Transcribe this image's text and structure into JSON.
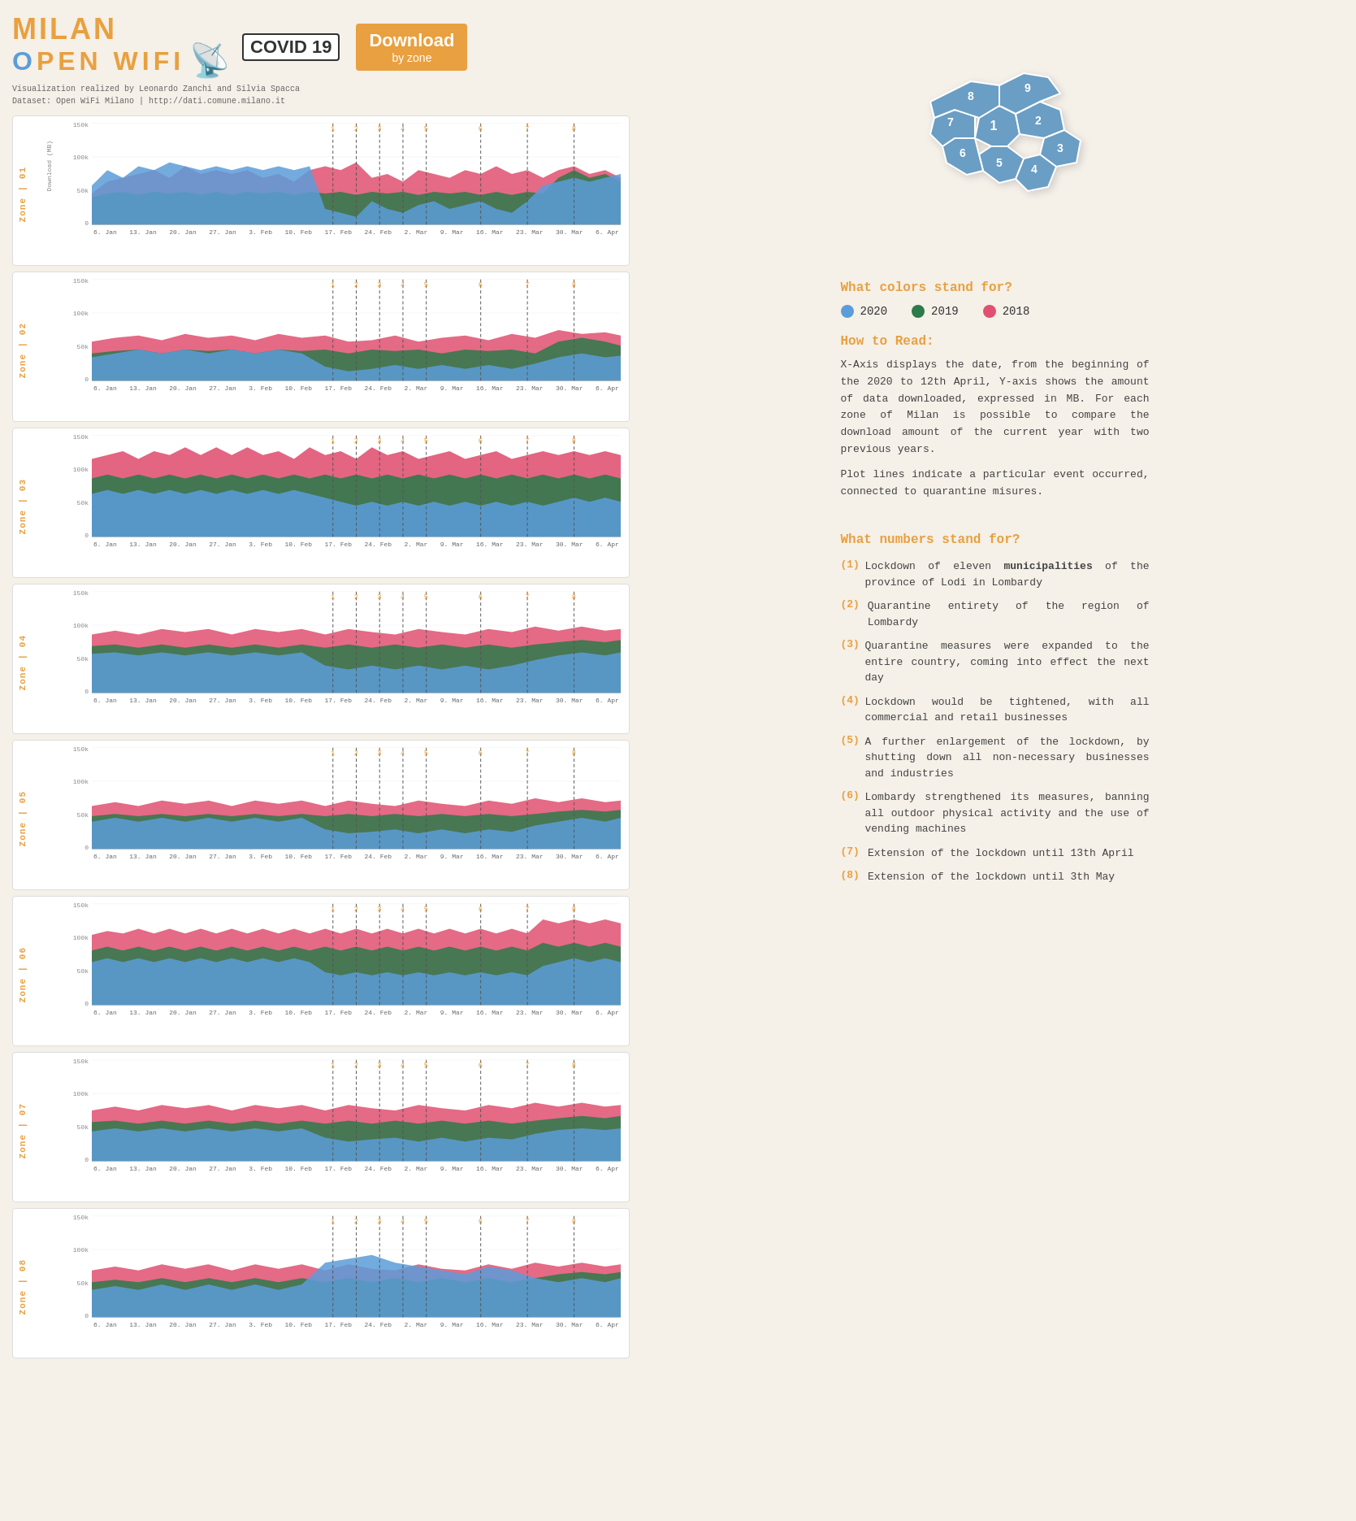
{
  "header": {
    "milan": "MILAN",
    "covid": "COVID 19",
    "open_wifi": "OPEN WIFI",
    "download": "Download",
    "by_zone": "by zone",
    "attribution1": "Visualization realized by Leonardo Zanchi and Silvia Spacca",
    "attribution2": "Dataset: Open WiFi Milano | http://dati.comune.milano.it"
  },
  "colors": {
    "year2020": "#5b9dd9",
    "year2019": "#2d7a4a",
    "year2018": "#e05070",
    "accent": "#e8a040",
    "dashed_line": "#555",
    "grid": "#eee"
  },
  "legend": {
    "title": "What colors stand for?",
    "items": [
      {
        "year": "2020",
        "color": "#5b9dd9"
      },
      {
        "year": "2019",
        "color": "#2d7a4a"
      },
      {
        "year": "2018",
        "color": "#e05070"
      }
    ]
  },
  "how_to_read": {
    "title": "How to Read:",
    "body1": "X-Axis displays the date, from the beginning of the 2020 to 12th April, Y-axis shows the amount of data downloaded, expressed in MB. For each zone of Milan is possible to compare the download amount of the current year with two previous years.",
    "body2": "Plot lines indicate a particular event occurred, connected to quarantine misures."
  },
  "what_numbers": {
    "title": "What numbers stand for?",
    "items": [
      {
        "num": "(1)",
        "text": "Lockdown of eleven ",
        "bold": "municipalities",
        "text2": " of the province of Lodi in Lombardy"
      },
      {
        "num": "(2)",
        "text": "Quarantine entirety of the region of Lombardy"
      },
      {
        "num": "(3)",
        "text": "Quarantine measures were expanded to the entire country, coming into effect the next day"
      },
      {
        "num": "(4)",
        "text": "Lockdown would be tightened, with all commercial and retail businesses"
      },
      {
        "num": "(5)",
        "text": "A further enlargement of the lockdown, by shutting down all non-necessary businesses and industries"
      },
      {
        "num": "(6)",
        "text": "Lombardy strengthened its measures, banning all outdoor physical activity and the use of vending machines"
      },
      {
        "num": "(7)",
        "text": "Extension of the lockdown until 13th April"
      },
      {
        "num": "(8)",
        "text": "Extension of the lockdown until 3th May"
      }
    ]
  },
  "zones": [
    {
      "id": "01",
      "label": "Zone | 01"
    },
    {
      "id": "02",
      "label": "Zone | 02"
    },
    {
      "id": "03",
      "label": "Zone | 03"
    },
    {
      "id": "04",
      "label": "Zone | 04"
    },
    {
      "id": "05",
      "label": "Zone | 05"
    },
    {
      "id": "06",
      "label": "Zone | 06"
    },
    {
      "id": "07",
      "label": "Zone | 07"
    },
    {
      "id": "08",
      "label": "Zone | 08"
    }
  ],
  "x_axis_labels": [
    "6. Jan",
    "13. Jan",
    "20. Jan",
    "27. Jan",
    "3. Feb",
    "10. Feb",
    "17. Feb",
    "24. Feb",
    "2. Mar",
    "9. Mar",
    "16. Mar",
    "23. Mar",
    "30. Mar",
    "6. Apr"
  ],
  "y_axis_labels": [
    "150k",
    "100k",
    "50k",
    "0"
  ]
}
